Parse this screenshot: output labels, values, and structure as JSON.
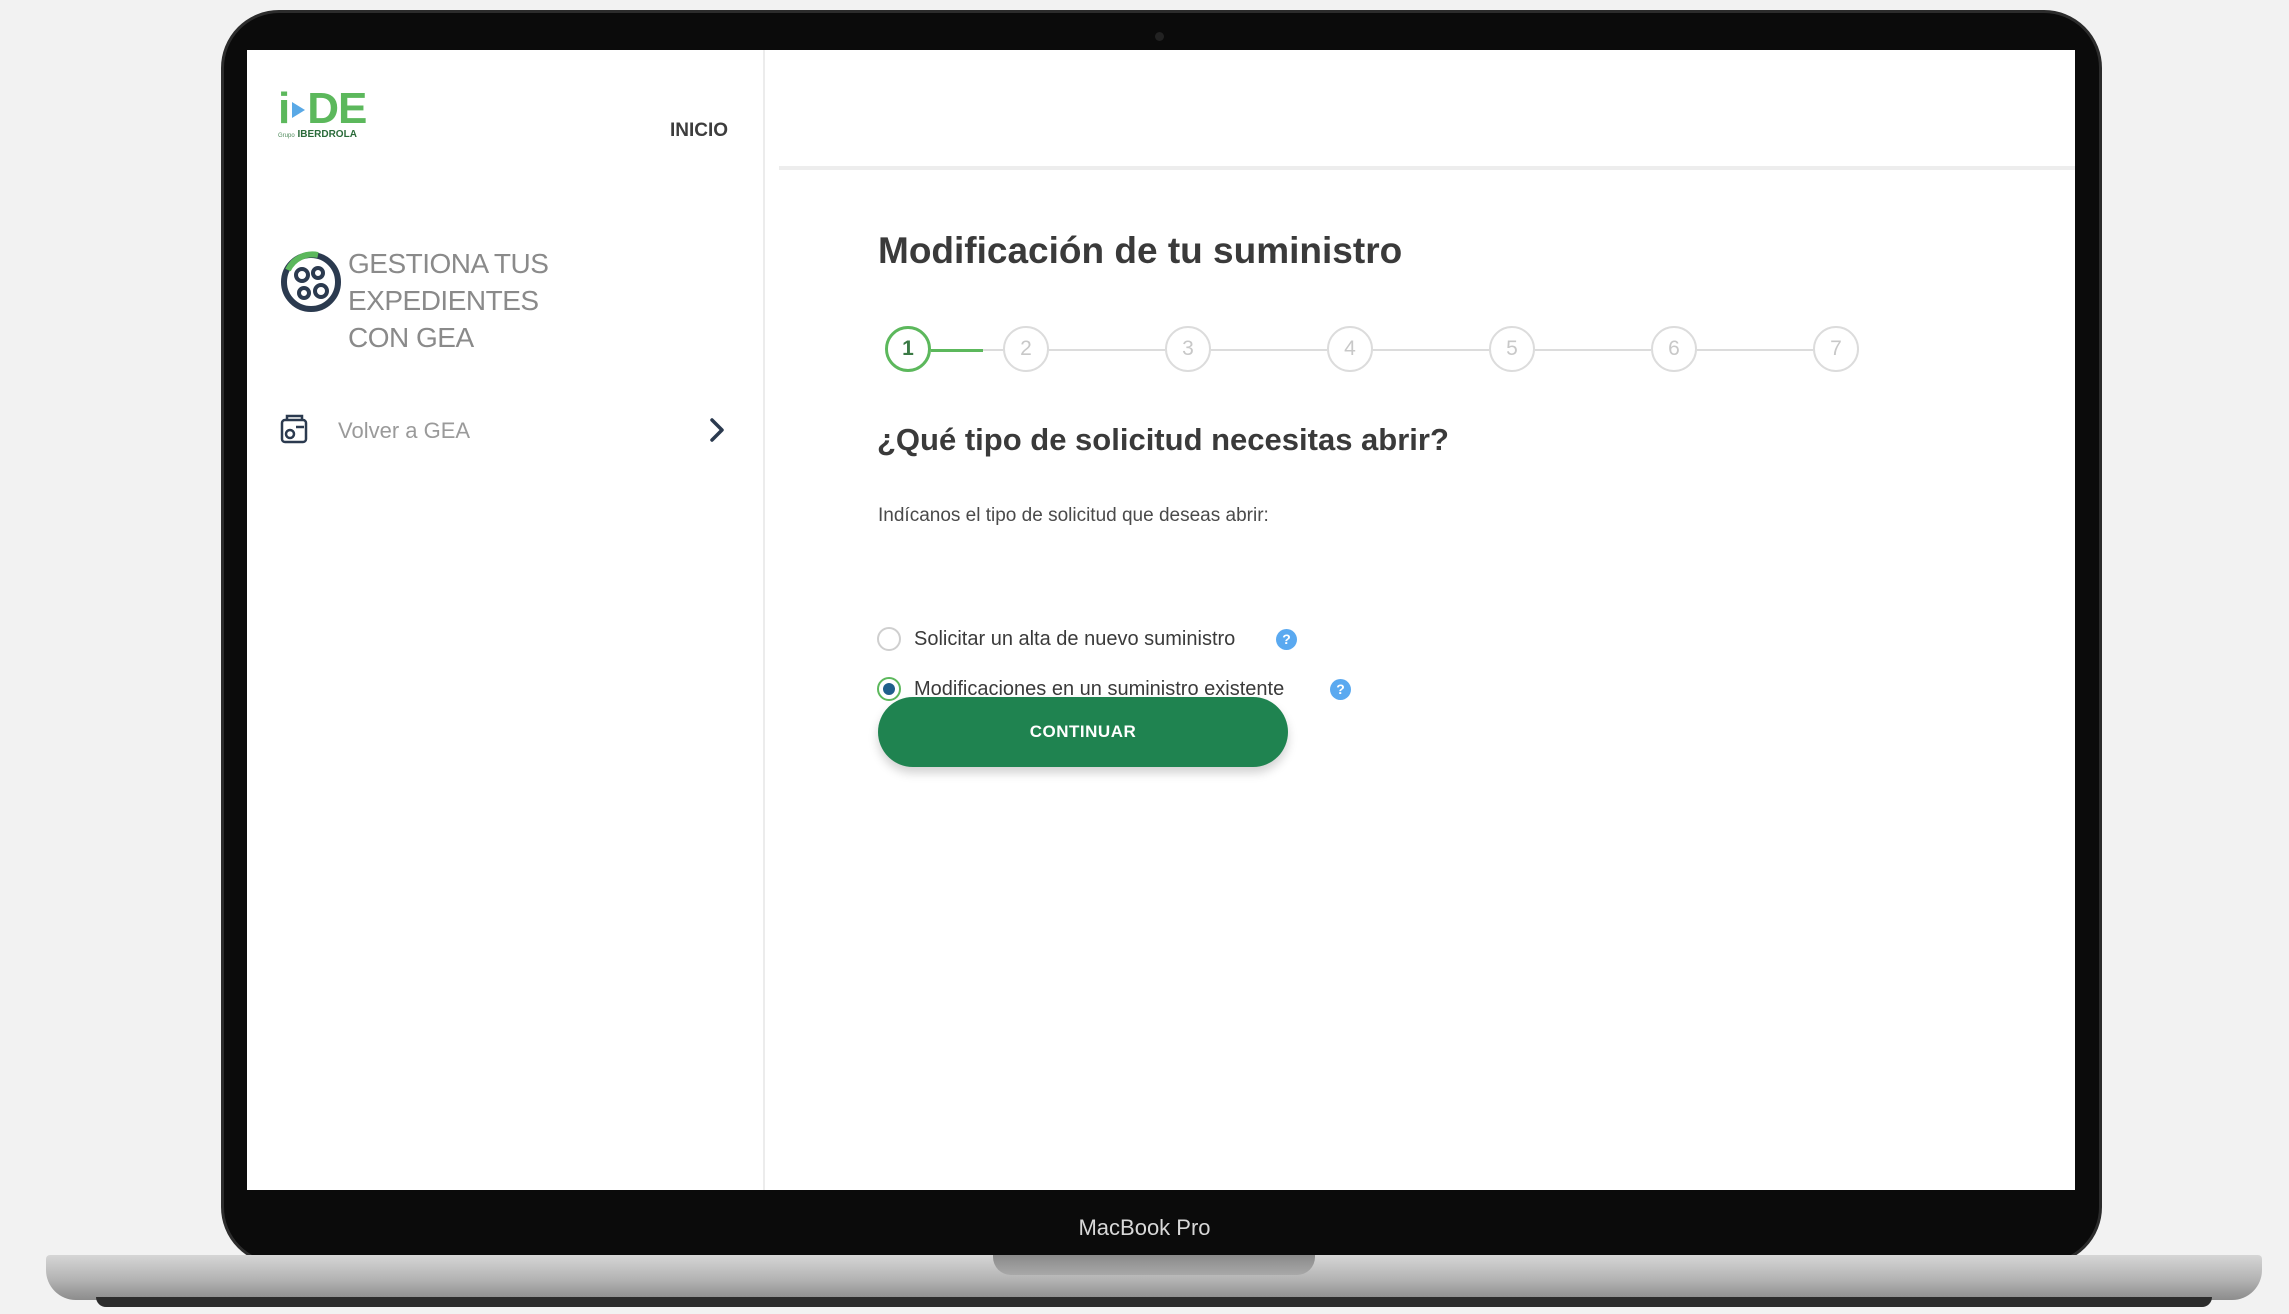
{
  "device": {
    "model_label": "MacBook Pro"
  },
  "logo": {
    "brand": "i-DE",
    "brand_i": "i",
    "brand_de": "DE",
    "tagline_prefix": "Grupo",
    "tagline": "IBERDROLA"
  },
  "header": {
    "home_link": "INICIO"
  },
  "sidebar": {
    "section_title_line1": "GESTIONA TUS EXPEDIENTES",
    "section_title_line2": "CON GEA",
    "back_link": "Volver a GEA"
  },
  "main": {
    "title": "Modificación de tu suministro",
    "steps": [
      "1",
      "2",
      "3",
      "4",
      "5",
      "6",
      "7"
    ],
    "current_step": 1,
    "question": "¿Qué tipo de solicitud necesitas abrir?",
    "helper": "Indícanos el tipo de solicitud que deseas abrir:",
    "options": [
      {
        "label": "Solicitar un alta de nuevo suministro",
        "checked": false
      },
      {
        "label": "Modificaciones en un suministro existente",
        "checked": true
      }
    ],
    "help_glyph": "?",
    "continue_label": "CONTINUAR"
  },
  "colors": {
    "brand_green": "#5cb85c",
    "button_green": "#1f8350",
    "help_blue": "#5aa9f0",
    "radio_dot": "#1f5f8b"
  }
}
